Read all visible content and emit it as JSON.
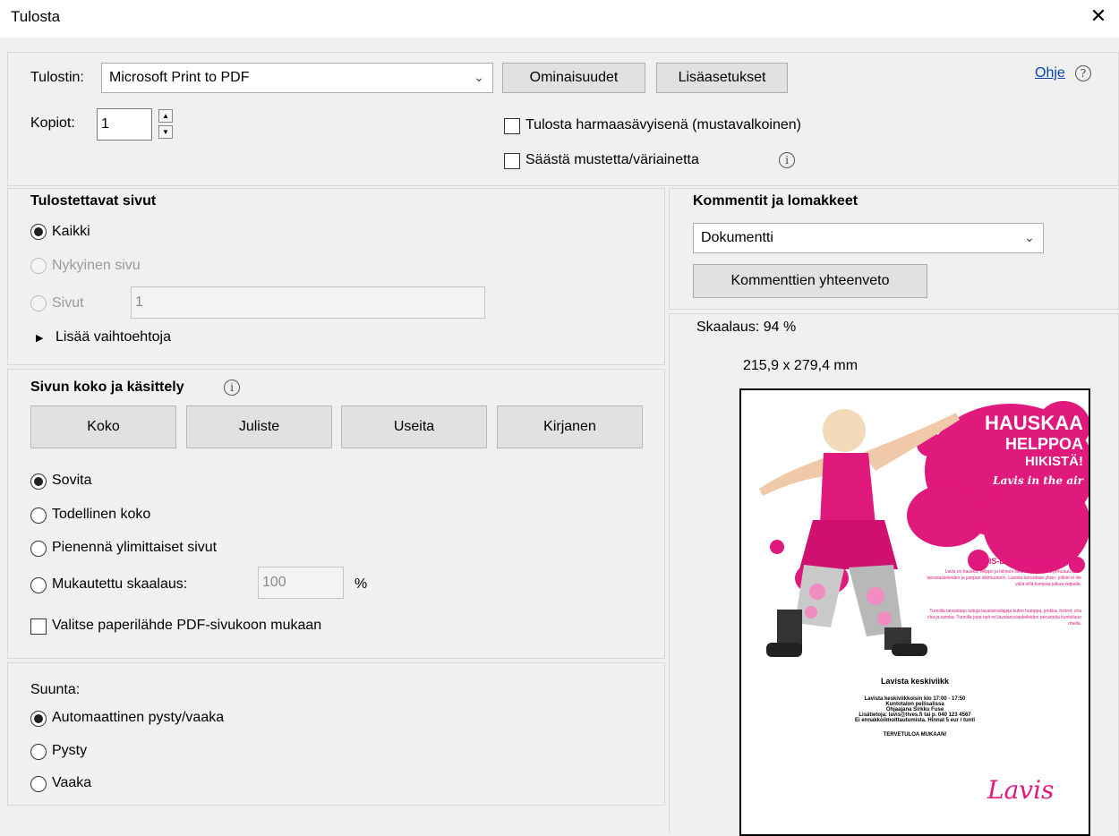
{
  "window": {
    "title": "Tulosta",
    "close_glyph": "✕"
  },
  "printer": {
    "label": "Tulostin:",
    "selected": "Microsoft Print to PDF",
    "properties_button": "Ominaisuudet",
    "advanced_button": "Lisäasetukset",
    "help_link": "Ohje",
    "copies_label": "Kopiot:",
    "copies_value": "1",
    "grayscale_label": "Tulosta harmaasävyisenä (mustavalkoinen)",
    "save_ink_label": "Säästä mustetta/väriainetta"
  },
  "pages": {
    "heading": "Tulostettavat sivut",
    "all": "Kaikki",
    "current": "Nykyinen sivu",
    "pages": "Sivut",
    "pages_value": "1",
    "more_options": "Lisää vaihtoehtoja"
  },
  "size": {
    "heading": "Sivun koko ja käsittely",
    "tabs": [
      "Koko",
      "Juliste",
      "Useita",
      "Kirjanen"
    ],
    "fit": "Sovita",
    "actual": "Todellinen koko",
    "shrink": "Pienennä ylimittaiset sivut",
    "custom": "Mukautettu skaalaus:",
    "custom_value": "100",
    "percent": "%",
    "paper_source": "Valitse paperilähde PDF-sivukoon mukaan"
  },
  "orientation": {
    "heading": "Suunta:",
    "auto": "Automaattinen pysty/vaaka",
    "portrait": "Pysty",
    "landscape": "Vaaka"
  },
  "comments": {
    "heading": "Kommentit ja lomakkeet",
    "selected": "Dokumentti",
    "summary_button": "Kommenttien yhteenveto"
  },
  "preview": {
    "scale": "Skaalaus:  94 %",
    "dimensions": "215,9 x 279,4 mm",
    "poster": {
      "headline1": "HAUSKAA",
      "headline2": "HELPPOA",
      "headline3": "HIKISTÄ!",
      "tagline": "Lavis in the air",
      "subtitle": "LAVIS-LAVATANSSIJUMPPA",
      "para1": "Lavis on hauska, helppo ja hikinen liikuntamuoto, joka perustuu lava-tanssiaskeleiden ja jumpan sikimuotoon. Lavista tanssitaan yksin, jolloin ei ole väliä sillä kumpaa jalkaa vatpaile.",
      "para2": "Tunnilla tanssitaan tuttuja lavatanssilajeja kuten humppa, jenkka, foxtrot, cha cha ja samba. Tunnilla jopa opit eri lavatanssiaskeleiden perusteita kuntoiluun ohella.",
      "event_title": "Lavista keskiviikk",
      "line1": "Lavista keskiviikkoisin klo 17:00 - 17:50",
      "line2": "Kuntotalon peilisalissa",
      "line3": "Ohjaajana Sirkku Fuse",
      "line4": "Lisätietoja: lavis@lives.fi tai p. 040 123 4567",
      "line5": "Ei ennakkoilmoittautumista. Hinnat 5 eur / tunti",
      "welcome": "TERVETULOA MUKAAN!",
      "logo": "Lavis"
    }
  },
  "colors": {
    "pink": "#e0197d",
    "link": "#0645ad"
  }
}
